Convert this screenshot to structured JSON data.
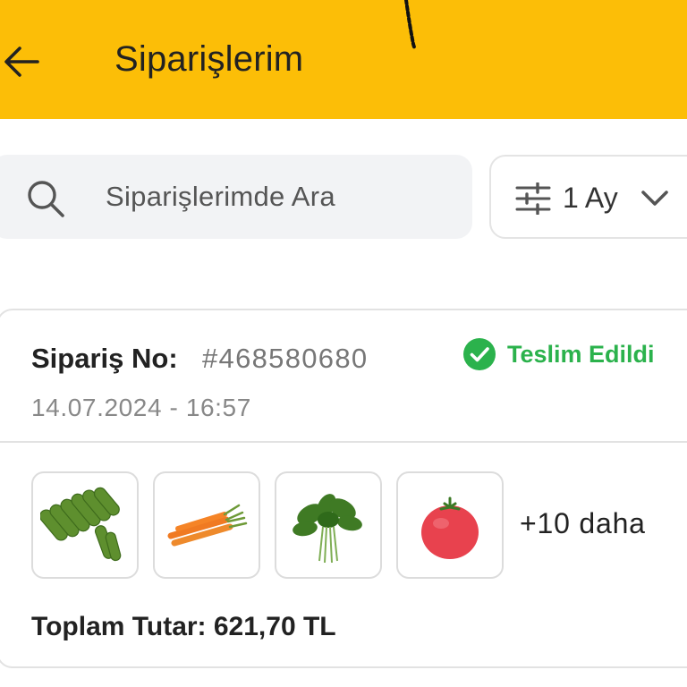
{
  "header": {
    "title": "Siparişlerim",
    "back_icon": "arrow-left-icon",
    "background_color": "#FCBE07"
  },
  "search": {
    "placeholder": "Siparişlerimde Ara",
    "icon": "search-icon"
  },
  "filter": {
    "label": "1 Ay",
    "icon": "sliders-icon",
    "dropdown_icon": "chevron-down-icon"
  },
  "order": {
    "number_label": "Sipariş No:",
    "number_value": "#468580680",
    "date": "14.07.2024 - 16:57",
    "status": "Teslim Edildi",
    "status_color": "#2BB24C",
    "status_icon": "check-circle-icon",
    "products": [
      {
        "icon": "cucumber-icon"
      },
      {
        "icon": "carrot-icon"
      },
      {
        "icon": "arugula-icon"
      },
      {
        "icon": "tomato-icon"
      }
    ],
    "more_items": "+10 daha",
    "total": "Toplam Tutar: 621,70 TL"
  }
}
